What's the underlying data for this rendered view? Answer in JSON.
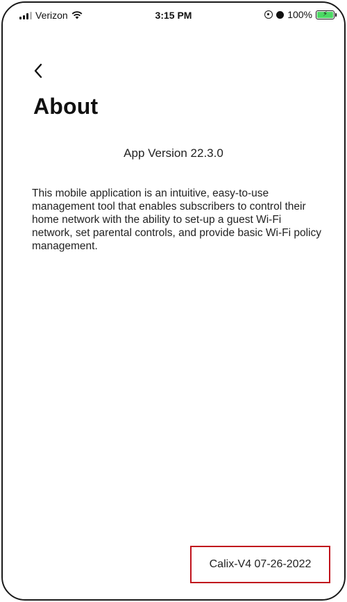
{
  "status_bar": {
    "carrier": "Verizon",
    "time": "3:15 PM",
    "battery": "100%"
  },
  "page": {
    "title": "About",
    "app_version": "App Version 22.3.0",
    "description": "This mobile application is an intuitive, easy-to-use management tool that enables subscribers to control their home network with the ability to set-up a guest Wi-Fi network, set parental controls, and provide basic Wi-Fi policy management.",
    "build_tag": "Calix-V4 07-26-2022"
  },
  "icons": {
    "back": "chevron-left-icon",
    "signal": "cell-signal-icon",
    "wifi": "wifi-icon",
    "battery": "battery-charging-icon"
  },
  "colors": {
    "highlight_border": "#c0121c",
    "battery_fill": "#4cd964"
  }
}
